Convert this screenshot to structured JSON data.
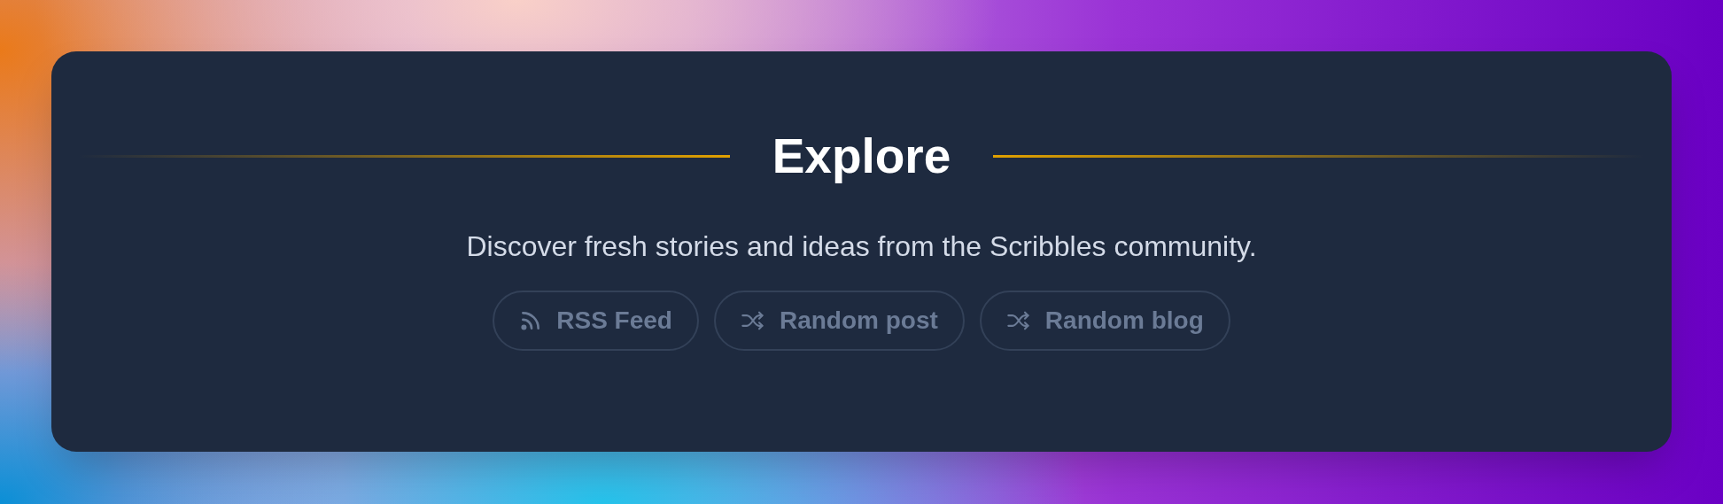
{
  "title": "Explore",
  "subtitle": "Discover fresh stories and ideas from the Scribbles community.",
  "buttons": [
    {
      "kind": "rss",
      "label": "RSS Feed"
    },
    {
      "kind": "shuffle",
      "label": "Random post"
    },
    {
      "kind": "shuffle",
      "label": "Random blog"
    }
  ]
}
